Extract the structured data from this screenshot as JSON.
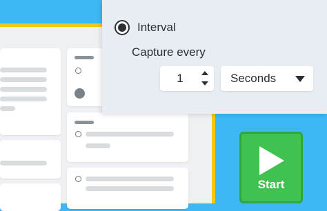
{
  "capture_settings": {
    "mode_label": "Interval",
    "mode_selected": true,
    "capture_every_label": "Capture every",
    "interval_value": "1",
    "unit_selected": "Seconds"
  },
  "start_button": {
    "label": "Start",
    "icon": "play-icon"
  },
  "colors": {
    "background_blue": "#3db8f5",
    "accent_yellow": "#f5c518",
    "start_green": "#3fc24f",
    "popover_bg": "#e8edf3"
  }
}
